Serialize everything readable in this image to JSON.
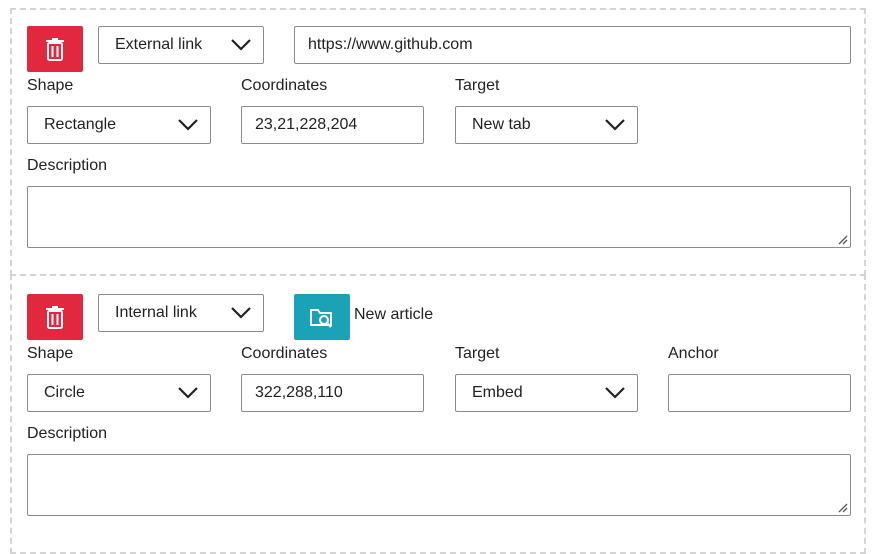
{
  "areas": [
    {
      "delete_icon": "trash-icon",
      "link_type": "External link",
      "url": "https://www.github.com",
      "shape_label": "Shape",
      "shape_value": "Rectangle",
      "coords_label": "Coordinates",
      "coords_value": "23,21,228,204",
      "target_label": "Target",
      "target_value": "New tab",
      "description_label": "Description",
      "description_value": ""
    },
    {
      "delete_icon": "trash-icon",
      "link_type": "Internal link",
      "browse_icon": "folder-search-icon",
      "article": "New article",
      "shape_label": "Shape",
      "shape_value": "Circle",
      "coords_label": "Coordinates",
      "coords_value": "322,288,110",
      "target_label": "Target",
      "target_value": "Embed",
      "anchor_label": "Anchor",
      "anchor_value": "",
      "description_label": "Description",
      "description_value": ""
    }
  ],
  "colors": {
    "delete": "#e1283f",
    "browse": "#1aa3b6",
    "border": "#8c8c8c",
    "panel_border": "#d4d4d4"
  }
}
